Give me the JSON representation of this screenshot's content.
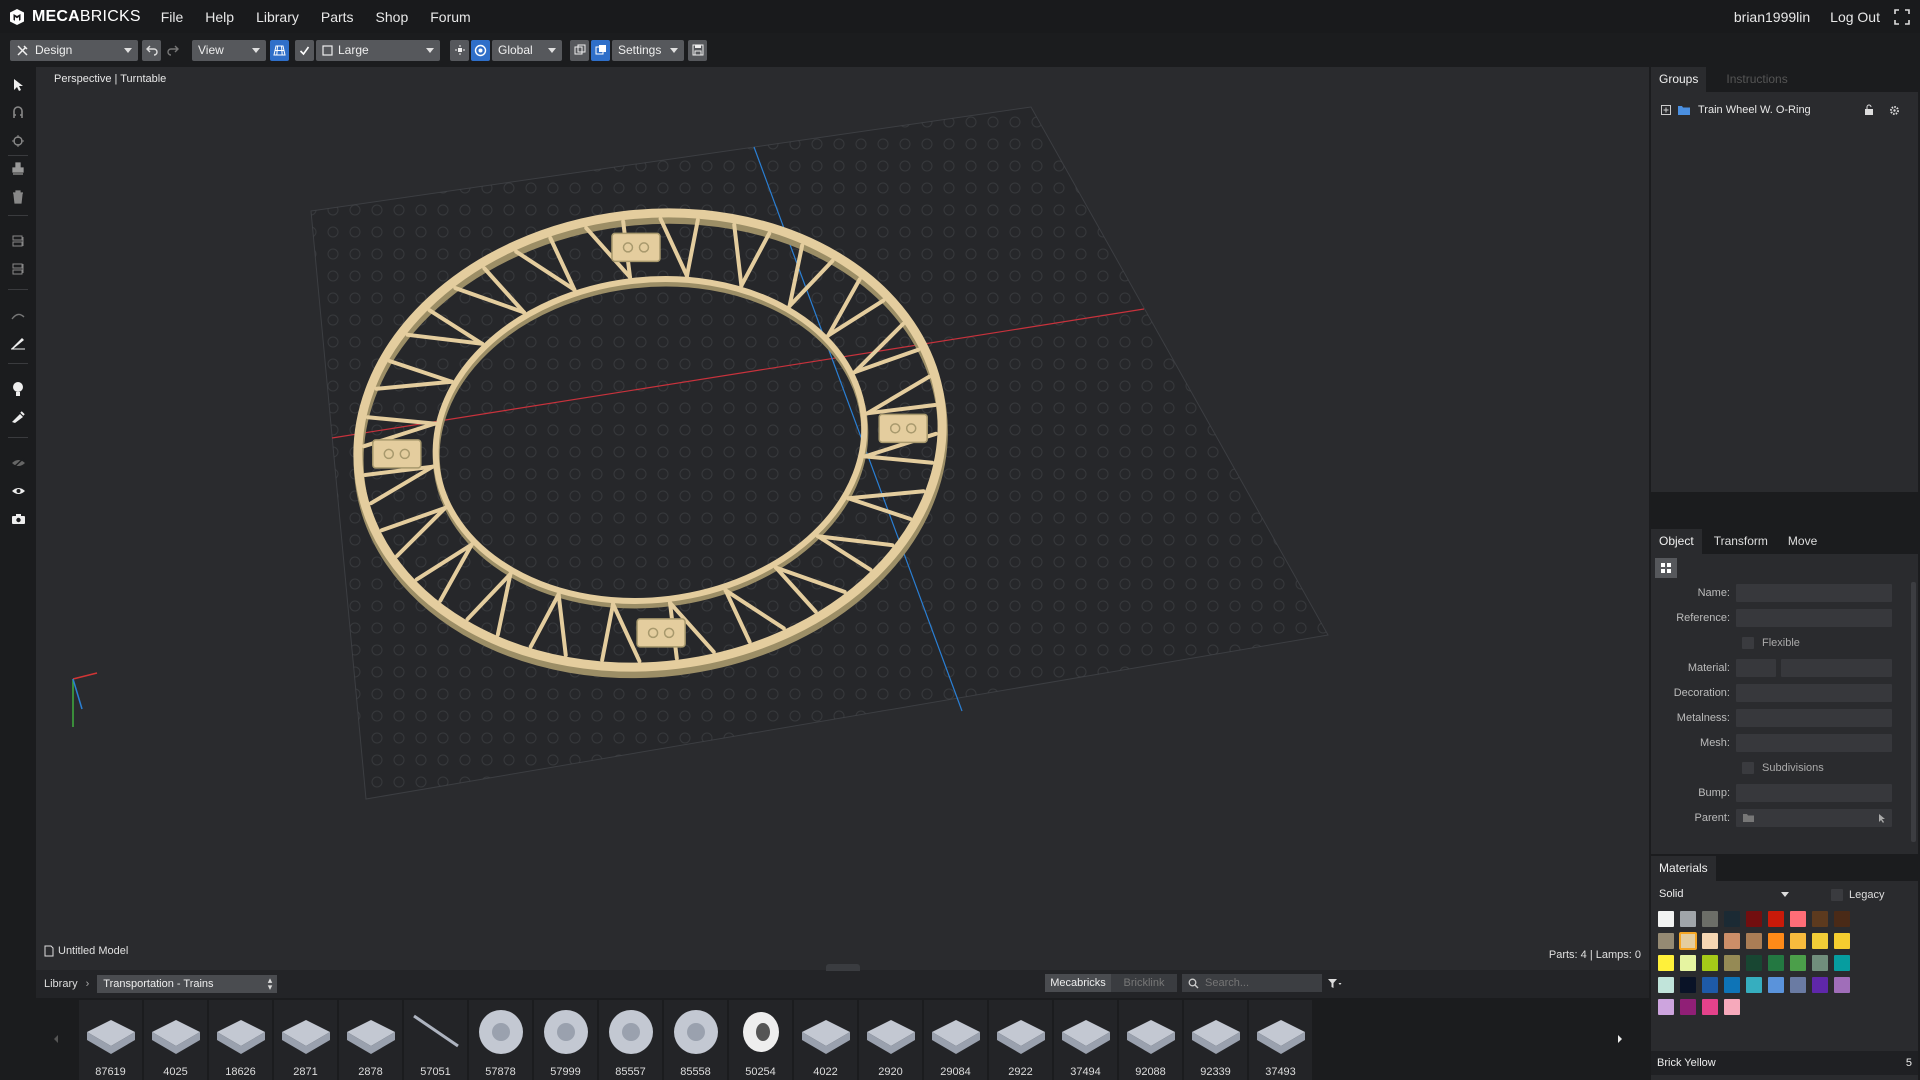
{
  "menubar": {
    "brand_bold": "MECA",
    "brand_rest": "BRICKS",
    "items": [
      "File",
      "Help",
      "Library",
      "Parts",
      "Shop",
      "Forum"
    ],
    "user": "brian1999lin",
    "logout": "Log Out"
  },
  "toolbar": {
    "mode": "Design",
    "view": "View",
    "size": "Large",
    "space": "Global",
    "settings": "Settings"
  },
  "viewport": {
    "camera_label": "Perspective | Turntable",
    "model_name": "Untitled Model",
    "stats": "Parts: 4 | Lamps: 0"
  },
  "groups_panel": {
    "tabs": [
      "Groups",
      "Instructions"
    ],
    "items": [
      {
        "label": "Train Wheel W. O-Ring"
      }
    ]
  },
  "object_panel": {
    "tabs": [
      "Object",
      "Transform",
      "Move"
    ],
    "labels": {
      "name": "Name:",
      "reference": "Reference:",
      "flexible": "Flexible",
      "material": "Material:",
      "decoration": "Decoration:",
      "metalness": "Metalness:",
      "mesh": "Mesh:",
      "subdivisions": "Subdivisions",
      "bump": "Bump:",
      "parent": "Parent:"
    }
  },
  "materials_panel": {
    "title": "Materials",
    "type": "Solid",
    "legacy": "Legacy",
    "selected_name": "Brick Yellow",
    "selected_id": "5",
    "swatches": [
      "#f2f3f2",
      "#a0a5a9",
      "#6c6e68",
      "#1b2a34",
      "#720e0f",
      "#c91a09",
      "#ff6d77",
      "#5c3a1e",
      "#4a2a17",
      "#958a73",
      "#e4cd9e",
      "#f6d7b3",
      "#cc8e68",
      "#aa7d55",
      "#fe8a18",
      "#f8bb3d",
      "#f2cd37",
      "#f5cd2f",
      "#fff03a",
      "#e6f4a1",
      "#a5ca18",
      "#958a55",
      "#184632",
      "#237841",
      "#4b9f4a",
      "#708e7c",
      "#069d9f",
      "#c1e4da",
      "#0a1327",
      "#1e5aa8",
      "#0e74b7",
      "#36aebf",
      "#5a93db",
      "#6a7ba3",
      "#5f27aa",
      "#a06eb9",
      "#cda4de",
      "#901f76",
      "#e4428b",
      "#f6a9bb"
    ]
  },
  "library": {
    "breadcrumb_root": "Library",
    "category": "Transportation - Trains",
    "source_tabs": [
      "Mecabricks",
      "Bricklink"
    ],
    "search_placeholder": "Search...",
    "parts": [
      "87619",
      "4025",
      "18626",
      "2871",
      "2878",
      "57051",
      "57878",
      "57999",
      "85557",
      "85558",
      "50254",
      "4022",
      "2920",
      "29084",
      "2922",
      "37494",
      "92088",
      "92339",
      "37493"
    ]
  },
  "colors": {
    "accent_blue": "#2f6fc9",
    "ring_color": "#e4cd9e",
    "axis_x": "#c8323c",
    "axis_z": "#2a7fd4"
  }
}
